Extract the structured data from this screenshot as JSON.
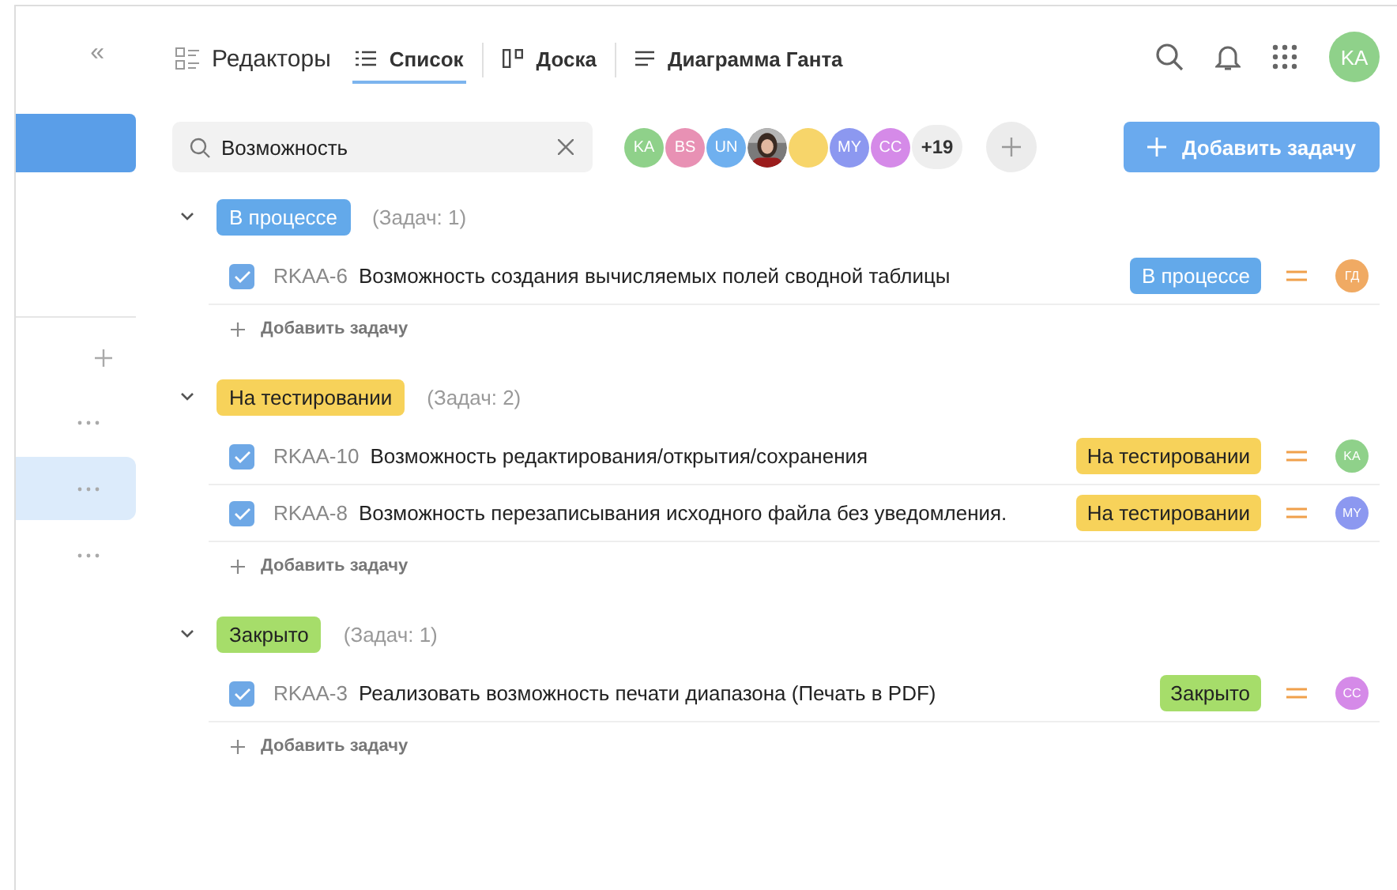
{
  "sidebar": {
    "collapse_icon": "«",
    "top_item": {
      "selected": true
    },
    "items": [
      {
        "selected": false
      },
      {
        "selected": true
      },
      {
        "selected": false
      }
    ]
  },
  "tabs": [
    {
      "label": "Редакторы",
      "selected": false
    },
    {
      "label": "Список",
      "selected": true
    },
    {
      "label": "Доска",
      "selected": false
    },
    {
      "label": "Диаграмма Ганта",
      "selected": false
    }
  ],
  "header": {
    "user_initials": "KA"
  },
  "search": {
    "value": "Возможность"
  },
  "members": [
    {
      "initials": "KA",
      "color": "#8fd18a",
      "kind": "initials"
    },
    {
      "initials": "BS",
      "color": "#e891b4",
      "kind": "initials"
    },
    {
      "initials": "UN",
      "color": "#6fb0ef",
      "kind": "initials"
    },
    {
      "kind": "picture"
    },
    {
      "color": "#f7d56a",
      "kind": "initials"
    },
    {
      "initials": "MY",
      "color": "#8c98f0",
      "kind": "initials"
    },
    {
      "initials": "CC",
      "color": "#d58ae8",
      "kind": "initials"
    },
    {
      "initials": "+19",
      "kind": "more"
    }
  ],
  "add_task_button": "Добавить задачу",
  "groups": [
    {
      "status": "В процессе",
      "color": "#63a9ea",
      "count": "(Задач: 1)",
      "expanded": true,
      "add_label": "Добавить задачу",
      "tasks": [
        {
          "checked": true,
          "id": "RKAA-6",
          "title": "Возможность создания вычисляемых полей сводной таблицы",
          "status": "В процессе",
          "assignee": "ГД",
          "color": "#f0aa63"
        }
      ]
    },
    {
      "status": "На тестировании",
      "color": "#f7d25a",
      "count": "(Задач: 2)",
      "expanded": true,
      "add_label": "Добавить задачу",
      "tasks": [
        {
          "checked": true,
          "id": "RKAA-10",
          "title": "Возможность редактирования/открытия/сохранения",
          "status": "На тестировании",
          "assignee": "KA",
          "color": "#8fd18a"
        },
        {
          "checked": true,
          "id": "RKAA-8",
          "title": "Возможность перезаписывания исходного файла без уведомления.",
          "status": "На тестировании",
          "assignee": "MY",
          "color": "#8c98f0"
        }
      ]
    },
    {
      "status": "Закрыто",
      "color": "#a6dd6a",
      "count": "(Задач: 1)",
      "expanded": true,
      "add_label": "Добавить задачу",
      "tasks": [
        {
          "checked": true,
          "id": "RKAA-3",
          "title": "Реализовать возможность печати диапазона (Печать в PDF)",
          "status": "Закрыто",
          "assignee": "CC",
          "color": "#d58ae8"
        }
      ]
    }
  ]
}
